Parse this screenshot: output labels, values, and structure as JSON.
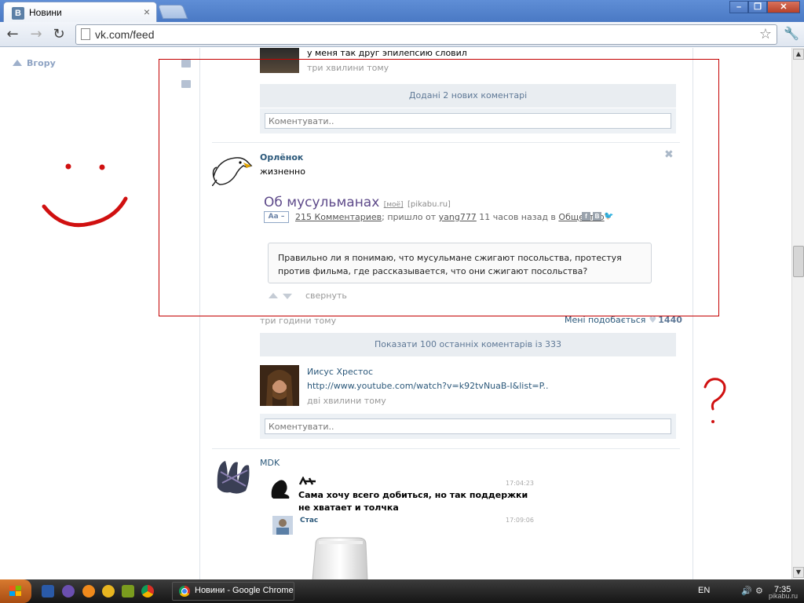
{
  "browser": {
    "tab_title": "Новини",
    "tab_favicon_letter": "В",
    "url": "vk.com/feed"
  },
  "sidebar": {
    "back_up_label": "Вгору"
  },
  "feed": {
    "top_comment": {
      "text": "у меня так друг эпилепсию словил",
      "time": "три хвилини тому"
    },
    "added_comments_bar": "Додані 2 нових коментарі",
    "comment_placeholder": "Коментувати..",
    "post": {
      "author": "Орлёнок",
      "text": "жизненно",
      "article": {
        "title": "Об мусульманах",
        "tag": "[моё]",
        "source": "[pikabu.ru]",
        "badge": "Аа –",
        "comments_link": "215 Комментариев",
        "meta_mid": "; пришло от ",
        "user_link": "yang777",
        "meta_time": " 11 часов назад в ",
        "category_link": "Общество",
        "quote": "Правильно ли я понимаю, что мусульмане сжигают посольства, протестуя против фильма, где рассказывается, что они сжигают посольства?",
        "collapse": "свернуть"
      },
      "time": "три години тому",
      "like_label": "Мені подобається",
      "like_count": "1440",
      "show_comments": "Показати 100 останніх коментарів із 333"
    },
    "jesus_comment": {
      "author": "Иисус Хрестос",
      "link": "http://www.youtube.com/watch?v=k92tvNuaB-I&list=P..",
      "time": "дві хвилини тому"
    },
    "mdk_post": {
      "author": "MDK",
      "msg1_time": "17:04:23",
      "msg1_text_line1": "Сама хочу всего добиться, но так поддержки",
      "msg1_text_line2": "не хватает  и толчка",
      "msg2_name": "Стас",
      "msg2_time": "17:09:06"
    }
  },
  "taskbar": {
    "task_label": "Новини - Google Chrome",
    "lang": "EN",
    "clock": "7:35"
  },
  "watermark": "pikabu.ru",
  "colors": {
    "vk_blue": "#2b587a",
    "annotation_red": "#c40000"
  }
}
